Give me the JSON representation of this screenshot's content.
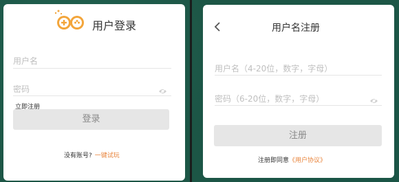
{
  "login": {
    "title": "用户登录",
    "username_placeholder": "用户名",
    "password_placeholder": "密码",
    "register_now": "立即注册",
    "login_button": "登录",
    "no_account": "没有账号?",
    "quick_trial": "一键试玩"
  },
  "register": {
    "title": "用户名注册",
    "username_placeholder": "用户名（4-20位，数字，字母）",
    "password_placeholder": "密码（6-20位，数字，字母）",
    "register_button": "注册",
    "agree_text": "注册即同意",
    "agreement_link": "《用户协议》"
  },
  "colors": {
    "background": "#1d5646",
    "accent_orange": "#e8833a",
    "button_gray": "#e6e6e6"
  },
  "icons": {
    "logo": "gamepad-logo-icon",
    "eye": "eye-icon",
    "back": "back-arrow-icon"
  }
}
